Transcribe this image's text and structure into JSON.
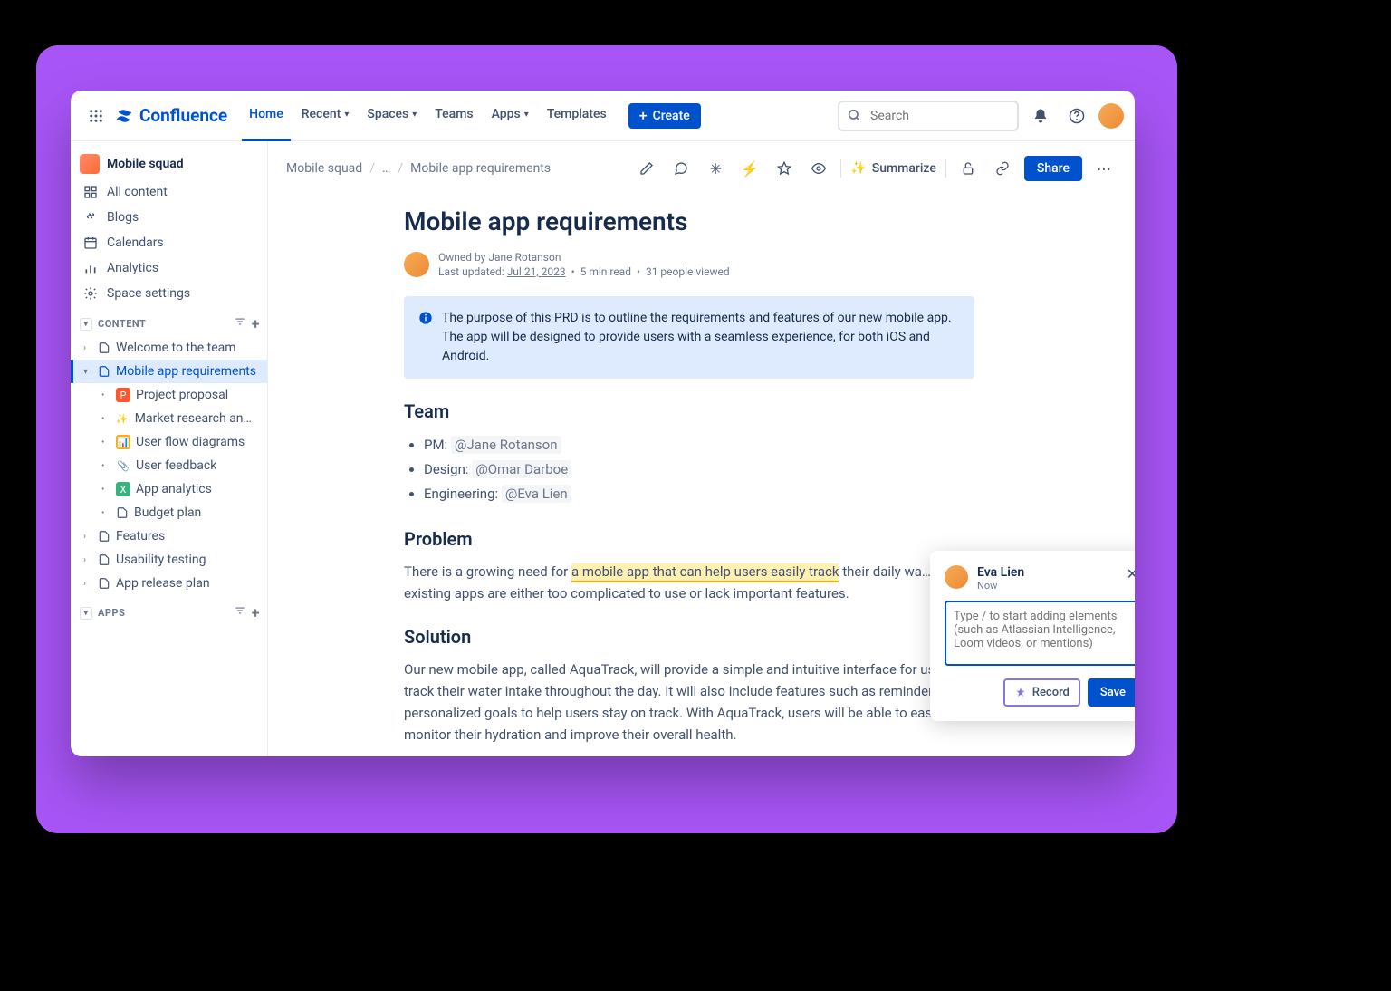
{
  "brand": "Confluence",
  "nav": {
    "home": "Home",
    "recent": "Recent",
    "spaces": "Spaces",
    "teams": "Teams",
    "apps": "Apps",
    "templates": "Templates",
    "create": "Create"
  },
  "search_placeholder": "Search",
  "space": {
    "name": "Mobile squad"
  },
  "side_links": {
    "all_content": "All content",
    "blogs": "Blogs",
    "calendars": "Calendars",
    "analytics": "Analytics",
    "space_settings": "Space settings"
  },
  "sections": {
    "content": "CONTENT",
    "apps": "APPS"
  },
  "tree": {
    "welcome": "Welcome to the team",
    "requirements": "Mobile app requirements",
    "proposal": "Project proposal",
    "market": "Market research and co…",
    "userflow": "User flow diagrams",
    "feedback": "User feedback",
    "analytics": "App analytics",
    "budget": "Budget plan",
    "features": "Features",
    "usability": "Usability testing",
    "release": "App release plan"
  },
  "breadcrumb": {
    "space": "Mobile squad",
    "middle": "…",
    "page": "Mobile app requirements"
  },
  "actions": {
    "summarize": "Summarize",
    "share": "Share"
  },
  "page": {
    "title": "Mobile app requirements",
    "owner_prefix": "Owned by ",
    "owner": "Jane Rotanson",
    "updated_prefix": "Last updated: ",
    "updated_date": "Jul 21, 2023",
    "read_time": "5 min read",
    "views": "31 people viewed",
    "info_panel": "The purpose of this PRD is to outline the requirements and features of our new mobile app. The app will be designed to provide users with a seamless experience, for both iOS and Android.",
    "sections": {
      "team": "Team",
      "problem": "Problem",
      "solution": "Solution"
    },
    "team": {
      "pm_label": "PM:  ",
      "pm": "@Jane Rotanson",
      "design_label": "Design:  ",
      "design": "@Omar Darboe",
      "eng_label": "Engineering:  ",
      "eng": "@Eva Lien"
    },
    "problem": {
      "pre": "There is a growing need for ",
      "highlight": "a mobile app that can help users easily track",
      "post": " their daily wa… Many existing apps are either too complicated to use or lack important features."
    },
    "solution_text": "Our new mobile app, called AquaTrack, will provide a simple and intuitive interface for users to track their water intake throughout the day. It will also include features such as reminders and personalized goals to help users stay on track. With AquaTrack, users will be able to easily monitor their hydration and improve their overall health."
  },
  "comment": {
    "user": "Eva Lien",
    "time": "Now",
    "placeholder": "Type / to start adding elements (such as Atlassian Intelligence, Loom videos, or mentions)",
    "record": "Record",
    "save": "Save"
  }
}
